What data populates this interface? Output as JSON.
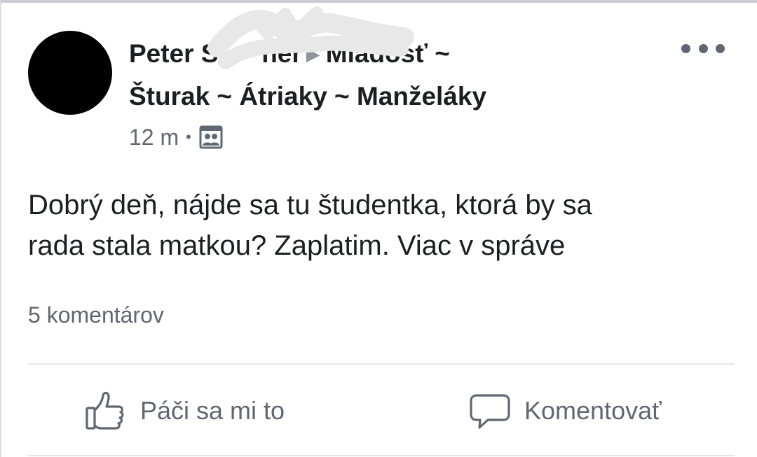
{
  "post": {
    "author": "Peter S",
    "author_obscured_suffix": "      ner",
    "group_line_1": "Mladosť ~",
    "group_line_2": "Šturak ~ Átriaky ~ Manželáky",
    "timestamp": "12 m",
    "separator": "•",
    "privacy_icon": "group-members-icon",
    "text_lines": [
      "Dobrý deň, nájde sa tu študentka, ktorá by sa",
      "rada stala matkou? Zaplatim. Viac v správe"
    ],
    "comments_count": "5 komentárov"
  },
  "actions": {
    "like_label": "Páči sa mi to",
    "comment_label": "Komentovať"
  },
  "colors": {
    "text_primary": "#1c1e21",
    "text_secondary": "#606770",
    "divider": "#e3e5e8",
    "avatar": "#000000"
  }
}
